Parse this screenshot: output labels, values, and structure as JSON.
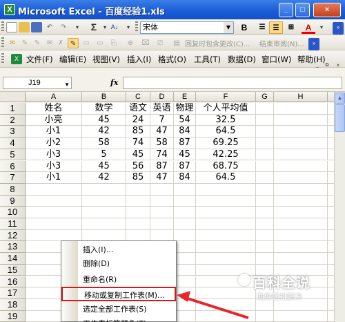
{
  "window": {
    "title": "Microsoft Excel - 百度经验1.xls",
    "minimize": "_",
    "restore": "□",
    "close": "×"
  },
  "toolbar": {
    "sum": "Σ",
    "font_name": "宋体",
    "bold": "B",
    "disabled_reply": "回复时包含更改(C)...",
    "disabled_end_review": "结束审阅(N)..."
  },
  "menu": {
    "items": [
      "文件(F)",
      "编辑(E)",
      "视图(V)",
      "插入(I)",
      "格式(O)",
      "工具(T)",
      "数据(D)",
      "窗口(W)",
      "帮助(H)"
    ]
  },
  "formula_bar": {
    "name_box": "J19",
    "fx": "fx",
    "value": ""
  },
  "sheet": {
    "columns": [
      "A",
      "B",
      "C",
      "D",
      "E",
      "F",
      "G",
      "H"
    ],
    "rows": [
      "1",
      "2",
      "3",
      "4",
      "5",
      "6",
      "7",
      "8",
      "9",
      "10",
      "11",
      "12",
      "13",
      "14",
      "15",
      "16",
      "17",
      "18",
      "19"
    ],
    "data": [
      [
        "姓名",
        "数学",
        "语文",
        "英语",
        "物理",
        "个人平均值"
      ],
      [
        "小亮",
        "45",
        "24",
        "7",
        "54",
        "32.5"
      ],
      [
        "小1",
        "42",
        "85",
        "47",
        "84",
        "64.5"
      ],
      [
        "小2",
        "58",
        "74",
        "58",
        "87",
        "69.25"
      ],
      [
        "小3",
        "5",
        "45",
        "74",
        "45",
        "42.25"
      ],
      [
        "小3",
        "45",
        "56",
        "87",
        "87",
        "68.75"
      ],
      [
        "小1",
        "42",
        "85",
        "47",
        "84",
        "64.5"
      ]
    ]
  },
  "context_menu": {
    "items": [
      {
        "label": "插入(I)...",
        "highlight": false
      },
      {
        "label": "删除(D)",
        "highlight": false
      },
      {
        "label": "重命名(R)",
        "highlight": false
      },
      {
        "label": "移动或复制工作表(M)...",
        "highlight": true
      },
      {
        "label": "选定全部工作表(S)",
        "highlight": false
      },
      {
        "label": "工作表标签颜色(T)...",
        "highlight": false
      }
    ]
  },
  "watermark": {
    "title": "百科全说",
    "subtitle": "助你轻松解决"
  },
  "colors": {
    "title_bar": "#1c5ed6",
    "highlight_border": "#d11a1a",
    "arrow": "#e8262b"
  }
}
